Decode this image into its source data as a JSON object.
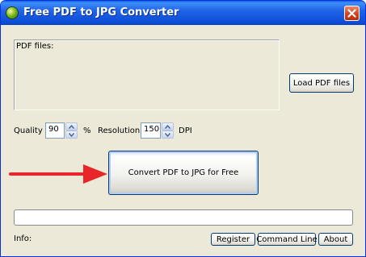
{
  "window": {
    "title": "Free PDF to JPG Converter",
    "titlebar_color": "#0d4dd6"
  },
  "pdf_files": {
    "label": "PDF files:"
  },
  "buttons": {
    "load": "Load PDF files",
    "convert": "Convert PDF to JPG for Free",
    "register": "Register",
    "command_line": "Command Line",
    "about": "About"
  },
  "quality": {
    "label": "Quality",
    "value": "90",
    "unit": "%"
  },
  "resolution": {
    "label": "Resolution",
    "value": "150",
    "unit": "DPI"
  },
  "info": {
    "label": "Info:"
  },
  "annotation": {
    "arrow_color": "#e8262a"
  }
}
